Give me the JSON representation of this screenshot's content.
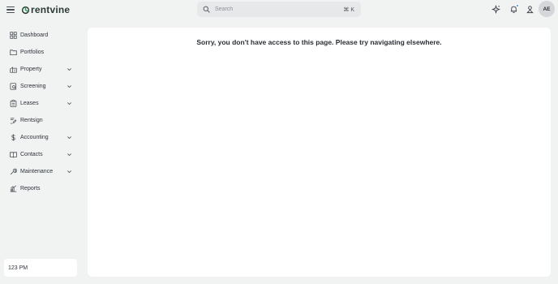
{
  "header": {
    "logo_text": "rentvine",
    "search": {
      "placeholder": "Search",
      "shortcut": "⌘ K"
    },
    "user_initials": "AE",
    "icons": [
      "menu-icon",
      "sparkle-icon",
      "bell-icon",
      "profile-icon"
    ]
  },
  "sidebar": {
    "items": [
      {
        "label": "Dashboard",
        "icon": "dashboard-icon",
        "expandable": false
      },
      {
        "label": "Portfolios",
        "icon": "folder-icon",
        "expandable": false
      },
      {
        "label": "Property",
        "icon": "building-icon",
        "expandable": true
      },
      {
        "label": "Screening",
        "icon": "screening-icon",
        "expandable": true
      },
      {
        "label": "Leases",
        "icon": "clipboard-icon",
        "expandable": true
      },
      {
        "label": "Rentsign",
        "icon": "signature-icon",
        "expandable": false
      },
      {
        "label": "Accounting",
        "icon": "dollar-icon",
        "expandable": true
      },
      {
        "label": "Contacts",
        "icon": "contacts-book-icon",
        "expandable": true
      },
      {
        "label": "Maintenance",
        "icon": "wrench-icon",
        "expandable": true
      },
      {
        "label": "Reports",
        "icon": "chart-icon",
        "expandable": false
      }
    ],
    "time": "123 PM"
  },
  "main": {
    "message": "Sorry, you don't have access to this page. Please try navigating elsewhere."
  },
  "colors": {
    "background": "#f1f2f2",
    "panel": "#ffffff",
    "notification_dot": "#2f80ed",
    "logo_accent": "#2e9c5a"
  }
}
